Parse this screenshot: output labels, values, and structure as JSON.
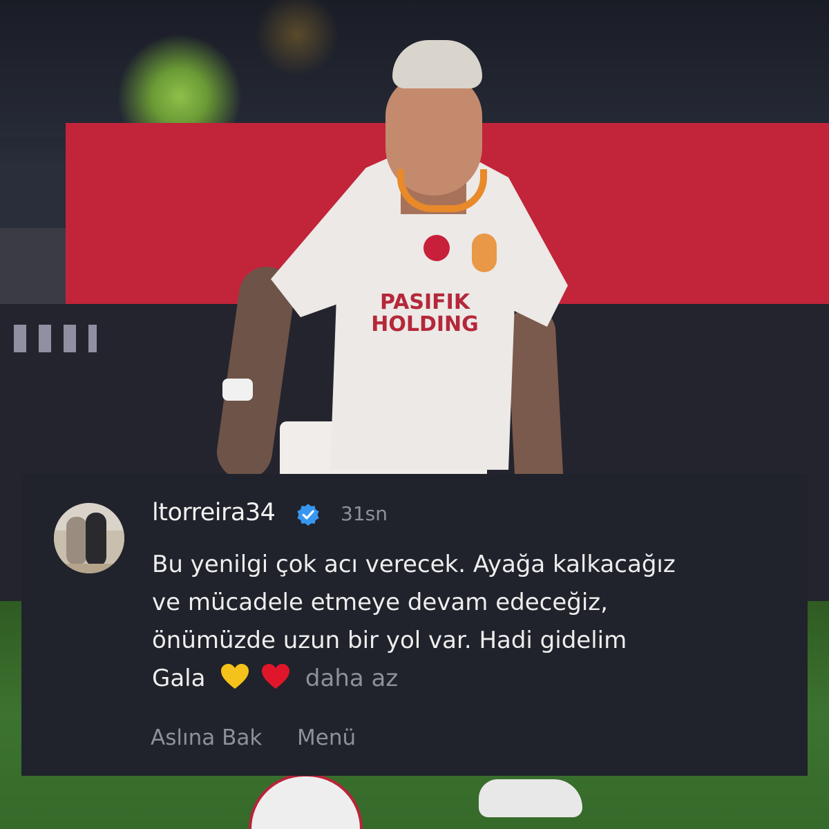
{
  "comment": {
    "username": "ltorreira34",
    "verified": true,
    "time_ago": "31sn",
    "text": "Bu yenilgi çok acı verecek. Ayağa kalkacağız ve mücadele etmeye devam edeceğiz, önümüzde uzun bir yol var. Hadi gidelim Gala",
    "emojis": [
      "yellow-heart-icon",
      "red-heart-icon"
    ],
    "collapse_label": "daha az",
    "actions": {
      "view_original": "Aslına Bak",
      "menu": "Menü"
    }
  },
  "photo": {
    "shirt_sponsor_line1": "PASIFIK",
    "shirt_sponsor_line2": "HOLDING"
  },
  "colors": {
    "card_background": "#20232b",
    "verified_blue": "#3797f0",
    "muted_text": "#8e9197",
    "primary_text": "#eeeeee",
    "yellow_heart": "#f5c21b",
    "red_heart": "#e0162b"
  }
}
